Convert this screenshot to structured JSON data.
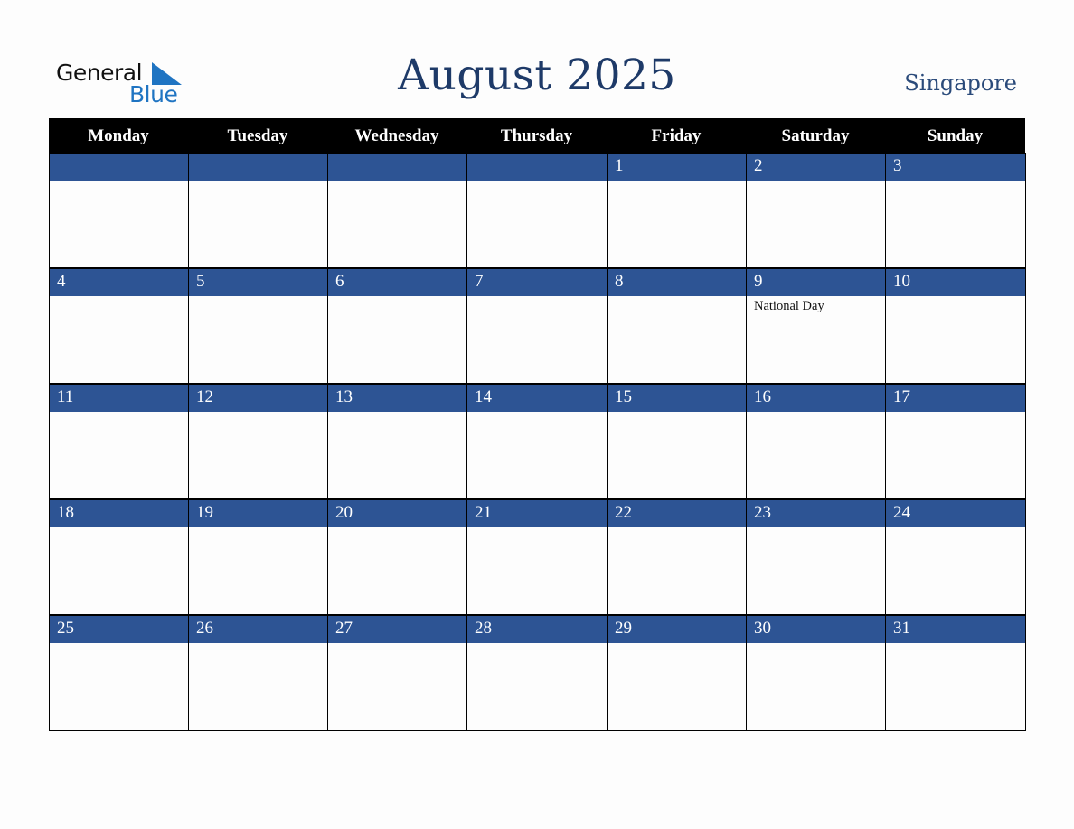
{
  "logo": {
    "word1": "General",
    "word2": "Blue"
  },
  "header": {
    "title": "August 2025",
    "country": "Singapore"
  },
  "colors": {
    "title": "#1e3a68",
    "band": "#2d5494",
    "header_bg": "#000000",
    "logo_blue": "#1f74c2"
  },
  "weekdays": [
    "Monday",
    "Tuesday",
    "Wednesday",
    "Thursday",
    "Friday",
    "Saturday",
    "Sunday"
  ],
  "weeks": [
    [
      {
        "day": "",
        "event": ""
      },
      {
        "day": "",
        "event": ""
      },
      {
        "day": "",
        "event": ""
      },
      {
        "day": "",
        "event": ""
      },
      {
        "day": "1",
        "event": ""
      },
      {
        "day": "2",
        "event": ""
      },
      {
        "day": "3",
        "event": ""
      }
    ],
    [
      {
        "day": "4",
        "event": ""
      },
      {
        "day": "5",
        "event": ""
      },
      {
        "day": "6",
        "event": ""
      },
      {
        "day": "7",
        "event": ""
      },
      {
        "day": "8",
        "event": ""
      },
      {
        "day": "9",
        "event": "National Day"
      },
      {
        "day": "10",
        "event": ""
      }
    ],
    [
      {
        "day": "11",
        "event": ""
      },
      {
        "day": "12",
        "event": ""
      },
      {
        "day": "13",
        "event": ""
      },
      {
        "day": "14",
        "event": ""
      },
      {
        "day": "15",
        "event": ""
      },
      {
        "day": "16",
        "event": ""
      },
      {
        "day": "17",
        "event": ""
      }
    ],
    [
      {
        "day": "18",
        "event": ""
      },
      {
        "day": "19",
        "event": ""
      },
      {
        "day": "20",
        "event": ""
      },
      {
        "day": "21",
        "event": ""
      },
      {
        "day": "22",
        "event": ""
      },
      {
        "day": "23",
        "event": ""
      },
      {
        "day": "24",
        "event": ""
      }
    ],
    [
      {
        "day": "25",
        "event": ""
      },
      {
        "day": "26",
        "event": ""
      },
      {
        "day": "27",
        "event": ""
      },
      {
        "day": "28",
        "event": ""
      },
      {
        "day": "29",
        "event": ""
      },
      {
        "day": "30",
        "event": ""
      },
      {
        "day": "31",
        "event": ""
      }
    ]
  ]
}
